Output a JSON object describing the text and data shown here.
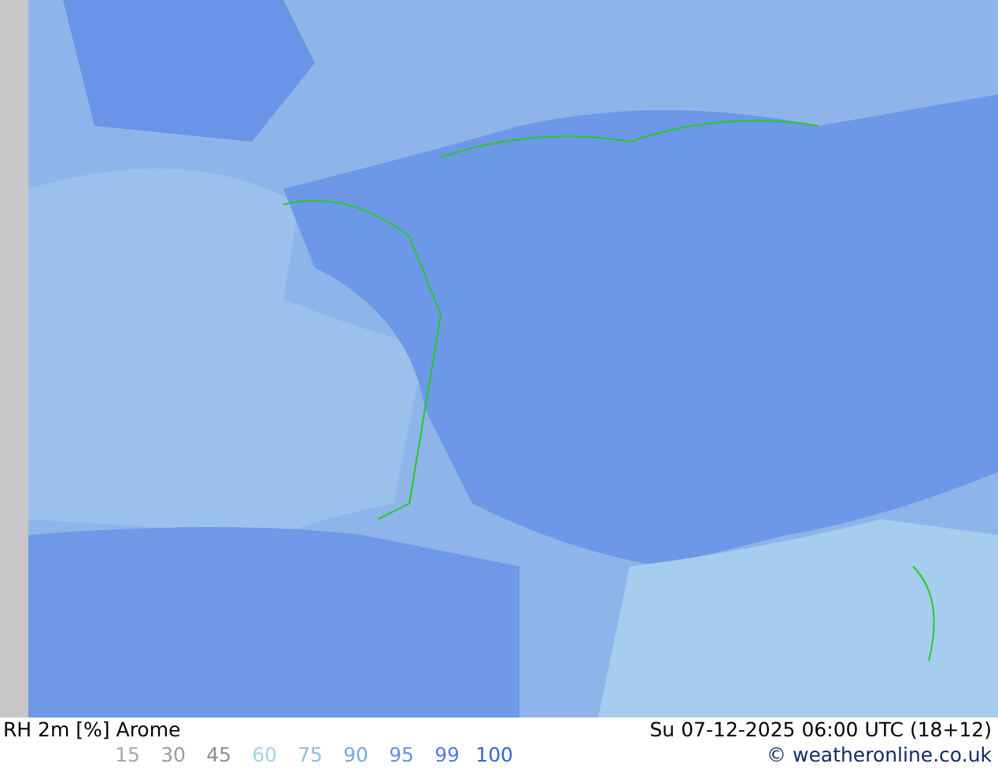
{
  "map": {
    "title": "RH 2m [%] Arome",
    "timestamp": "Su 07-12-2025 06:00 UTC (18+12)",
    "credit": "© weatheronline.co.uk"
  },
  "legend": [
    {
      "label": "15",
      "color": "#a8a8a8"
    },
    {
      "label": "30",
      "color": "#9c9c9c"
    },
    {
      "label": "45",
      "color": "#8e8e8e"
    },
    {
      "label": "60",
      "color": "#a0d4e6"
    },
    {
      "label": "75",
      "color": "#8cc0e2"
    },
    {
      "label": "90",
      "color": "#78a8e6"
    },
    {
      "label": "95",
      "color": "#6090e6"
    },
    {
      "label": "99",
      "color": "#4c7ae4"
    },
    {
      "label": "100",
      "color": "#3462e0"
    }
  ]
}
